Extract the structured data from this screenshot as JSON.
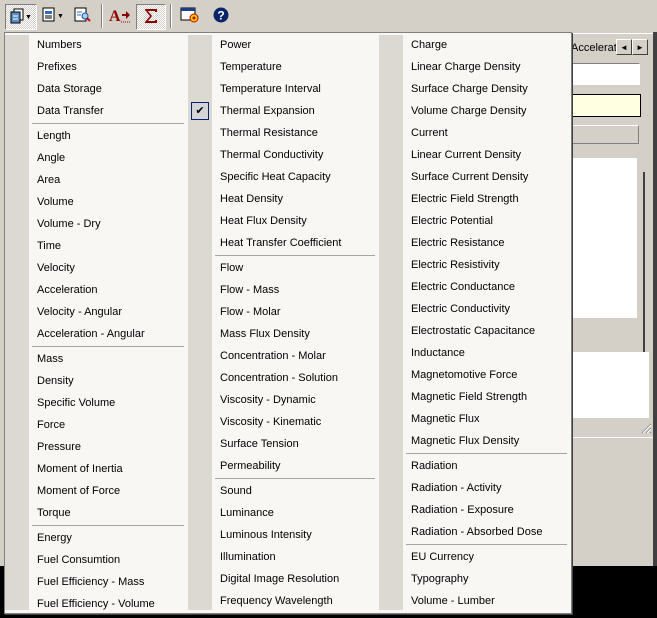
{
  "toolbar": {
    "buttons": [
      {
        "name": "copy-menu-icon",
        "has_dropdown": true,
        "pressed": true
      },
      {
        "name": "document-menu-icon",
        "has_dropdown": true
      },
      {
        "name": "find-icon"
      },
      {
        "name": "convert-text-icon"
      },
      {
        "name": "sum-icon",
        "pressed": true
      },
      {
        "name": "settings-window-icon"
      },
      {
        "name": "help-icon"
      }
    ]
  },
  "background": {
    "tab_label": "Accelerat",
    "tab_prev_icon": "◄",
    "tab_next_icon": "►"
  },
  "menu": {
    "checked_item": "Thermal Expansion",
    "check_glyph": "✔",
    "columns": [
      {
        "groups": [
          [
            "Numbers",
            "Prefixes",
            "Data Storage",
            "Data Transfer"
          ],
          [
            "Length",
            "Angle",
            "Area",
            "Volume",
            "Volume - Dry",
            "Time",
            "Velocity",
            "Acceleration",
            "Velocity - Angular",
            "Acceleration - Angular"
          ],
          [
            "Mass",
            "Density",
            "Specific Volume",
            "Force",
            "Pressure",
            "Moment of Inertia",
            "Moment of Force",
            "Torque"
          ],
          [
            "Energy",
            "Fuel Consumtion",
            "Fuel Efficiency - Mass",
            "Fuel Efficiency - Volume"
          ]
        ]
      },
      {
        "groups": [
          [
            "Power",
            "Temperature",
            "Temperature Interval",
            "Thermal Expansion",
            "Thermal Resistance",
            "Thermal Conductivity",
            "Specific Heat Capacity",
            "Heat Density",
            "Heat Flux Density",
            "Heat Transfer Coefficient"
          ],
          [
            "Flow",
            "Flow - Mass",
            "Flow - Molar",
            "Mass Flux Density",
            "Concentration - Molar",
            "Concentration - Solution",
            "Viscosity - Dynamic",
            "Viscosity - Kinematic",
            "Surface Tension",
            "Permeability"
          ],
          [
            "Sound",
            "Luminance",
            "Luminous Intensity",
            "Illumination",
            "Digital Image Resolution",
            "Frequency Wavelength"
          ]
        ]
      },
      {
        "groups": [
          [
            "Charge",
            "Linear Charge Density",
            "Surface Charge Density",
            "Volume Charge Density",
            "Current",
            "Linear Current Density",
            "Surface Current Density",
            "Electric Field Strength",
            "Electric Potential",
            "Electric Resistance",
            "Electric Resistivity",
            "Electric Conductance",
            "Electric Conductivity",
            "Electrostatic Capacitance",
            "Inductance",
            "Magnetomotive Force",
            "Magnetic Field Strength",
            "Magnetic Flux",
            "Magnetic Flux Density"
          ],
          [
            "Radiation",
            "Radiation - Activity",
            "Radiation - Exposure",
            "Radiation - Absorbed Dose"
          ],
          [
            "EU Currency",
            "Typography",
            "Volume - Lumber"
          ]
        ]
      }
    ]
  }
}
